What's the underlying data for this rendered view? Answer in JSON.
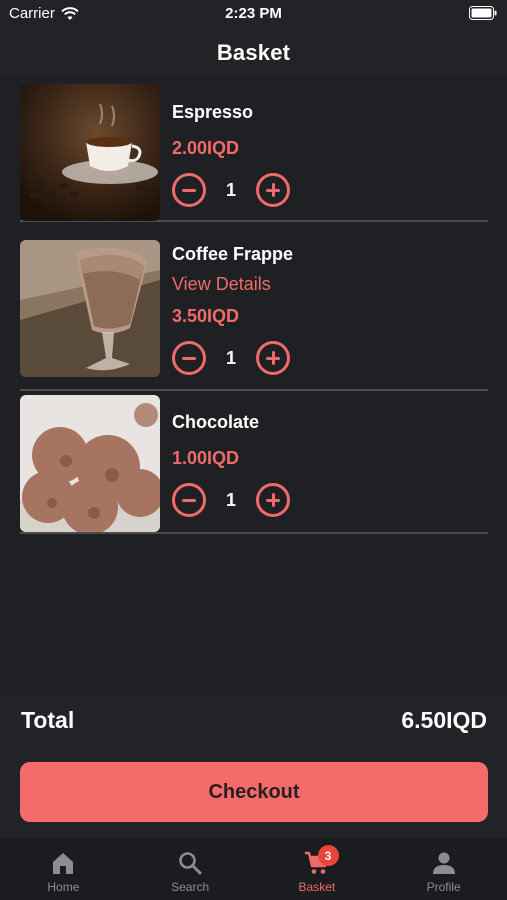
{
  "status_bar": {
    "carrier": "Carrier",
    "time": "2:23 PM"
  },
  "header": {
    "title": "Basket"
  },
  "items": [
    {
      "name": "Espresso",
      "price": "2.00IQD",
      "quantity": "1",
      "image": "espresso-cup-image"
    },
    {
      "name": "Coffee Frappe",
      "details_link": "View Details",
      "price": "3.50IQD",
      "quantity": "1",
      "image": "coffee-frappe-image"
    },
    {
      "name": "Chocolate",
      "price": "1.00IQD",
      "quantity": "1",
      "image": "chocolate-ice-cream-image"
    }
  ],
  "summary": {
    "total_label": "Total",
    "total_value": "6.50IQD"
  },
  "checkout": {
    "label": "Checkout"
  },
  "tabbar": {
    "tabs": [
      {
        "label": "Home",
        "icon": "home-icon"
      },
      {
        "label": "Search",
        "icon": "search-icon"
      },
      {
        "label": "Basket",
        "icon": "cart-icon",
        "badge": "3",
        "active": true
      },
      {
        "label": "Profile",
        "icon": "person-icon"
      }
    ]
  },
  "colors": {
    "accent": "#f06a6a",
    "background": "#222326",
    "button": "#f56b6b",
    "badge": "#e8453c"
  }
}
